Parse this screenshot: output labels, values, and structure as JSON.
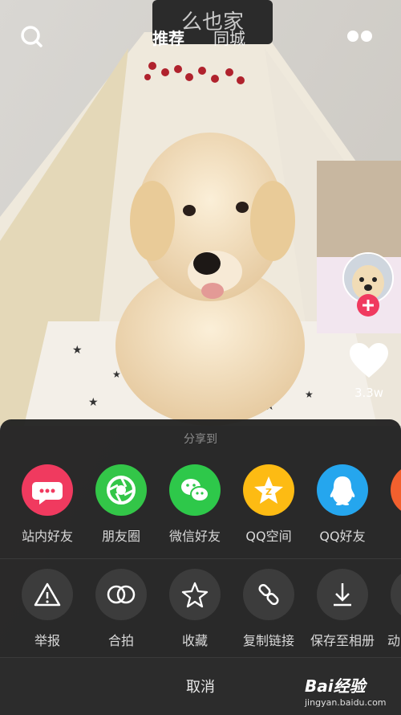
{
  "header": {
    "tabs": [
      {
        "label": "推荐",
        "active": true
      },
      {
        "label": "同城",
        "active": false
      }
    ]
  },
  "video": {
    "sign_text": "么也家",
    "like_count": "3.3w"
  },
  "share_sheet": {
    "title": "分享到",
    "share_targets": [
      {
        "label": "站内好友",
        "color": "#f03a5f",
        "icon": "chat-bubble-icon"
      },
      {
        "label": "朋友圈",
        "color": "#33c648",
        "icon": "moments-shutter-icon"
      },
      {
        "label": "微信好友",
        "color": "#2ec84a",
        "icon": "wechat-icon"
      },
      {
        "label": "QQ空间",
        "color": "#fdbb13",
        "icon": "qzone-star-icon"
      },
      {
        "label": "QQ好友",
        "color": "#25a6ee",
        "icon": "qq-penguin-icon"
      }
    ],
    "actions": [
      {
        "label": "举报",
        "icon": "warning-triangle-icon"
      },
      {
        "label": "合拍",
        "icon": "duet-circles-icon"
      },
      {
        "label": "收藏",
        "icon": "star-icon"
      },
      {
        "label": "复制链接",
        "icon": "link-icon"
      },
      {
        "label": "保存至相册",
        "icon": "download-icon"
      },
      {
        "label": "动",
        "icon": "more-action-icon"
      }
    ],
    "cancel_label": "取消"
  },
  "watermark": {
    "brand": "Bai经验",
    "url": "jingyan.baidu.com"
  }
}
